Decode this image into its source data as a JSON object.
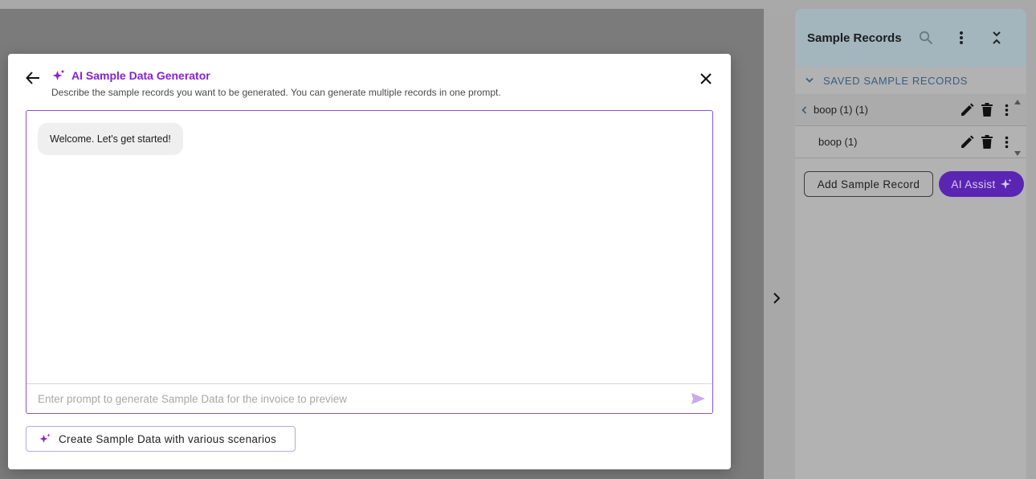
{
  "modal": {
    "title": "AI Sample Data Generator",
    "subtitle": "Describe the sample records you want to be generated. You can generate multiple records in one prompt.",
    "welcome_message": "Welcome. Let's get started!",
    "input_placeholder": "Enter prompt to generate Sample Data for the invoice to preview",
    "scenario_button_label": "Create Sample Data with various scenarios"
  },
  "panel": {
    "title": "Sample Records",
    "section_label": "SAVED SAMPLE RECORDS",
    "records": [
      {
        "label": "boop (1) (1)"
      },
      {
        "label": "boop (1)"
      }
    ],
    "add_button_label": "Add Sample Record",
    "ai_button_label": "AI Assist"
  },
  "colors": {
    "accent_purple": "#8a1fd0",
    "ai_button": "#5b25b4",
    "panel_header": "#a3b5bd",
    "section_label": "#385f80"
  }
}
